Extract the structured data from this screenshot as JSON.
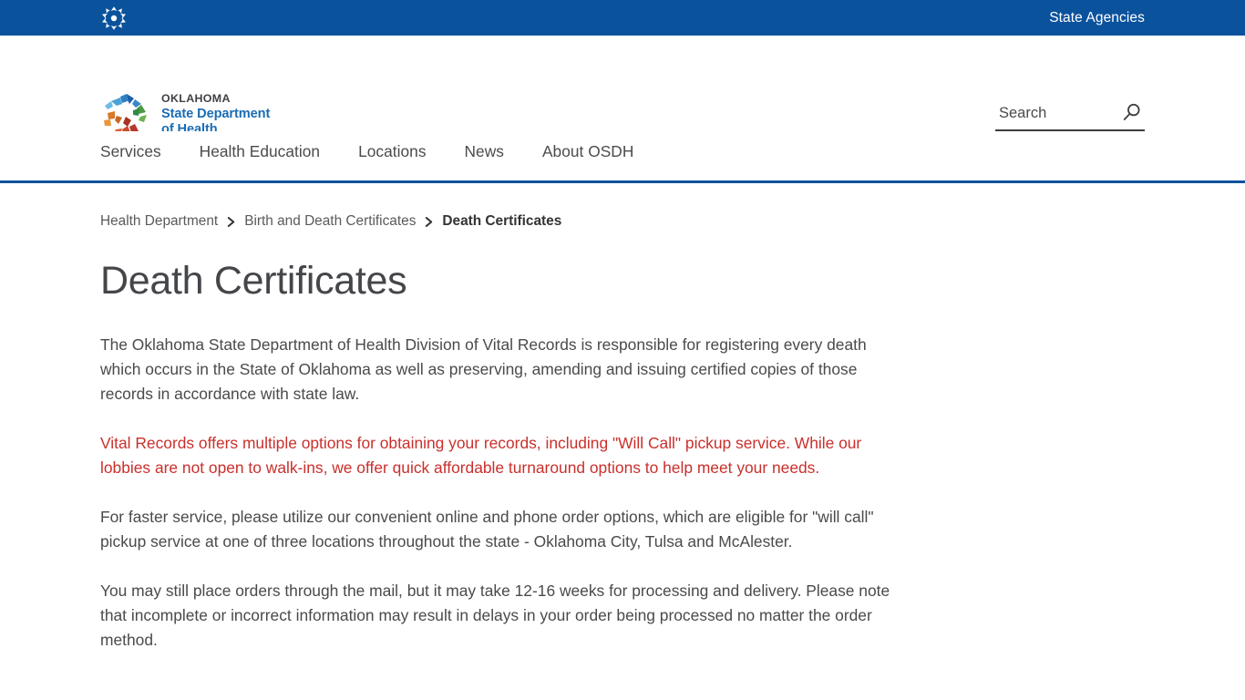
{
  "colors": {
    "brand_blue": "#0b529d",
    "alert_red": "#c9302c",
    "body_text": "#4a4a4a",
    "title_gray": "#44464a"
  },
  "topbar": {
    "seal_icon": "oklahoma-state-seal-icon",
    "links": [
      {
        "label": "State Agencies"
      }
    ]
  },
  "header": {
    "logo": {
      "mark_icon": "osdh-pinwheel-logo-icon",
      "line1": "OKLAHOMA",
      "line2": "State Department",
      "line3": "of Health"
    },
    "search": {
      "placeholder": "Search",
      "value": "",
      "icon": "search-icon"
    }
  },
  "nav": {
    "items": [
      {
        "label": "Services"
      },
      {
        "label": "Health Education"
      },
      {
        "label": "Locations"
      },
      {
        "label": "News"
      },
      {
        "label": "About OSDH"
      }
    ]
  },
  "breadcrumb": {
    "separator_icon": "chevron-right-icon",
    "items": [
      {
        "label": "Health Department",
        "current": false
      },
      {
        "label": "Birth and Death Certificates",
        "current": false
      },
      {
        "label": "Death Certificates",
        "current": true
      }
    ]
  },
  "main": {
    "title": "Death Certificates",
    "paragraphs": [
      {
        "style": "normal",
        "text": "The Oklahoma State Department of Health Division of Vital Records is responsible for registering every death which occurs in the State of Oklahoma as well as preserving, amending and issuing certified copies of those records in accordance with state law."
      },
      {
        "style": "alert",
        "text": "Vital Records offers multiple options for obtaining your records, including \"Will Call\" pickup service. While our lobbies are not open to walk-ins, we offer quick affordable turnaround options to help meet your needs."
      },
      {
        "style": "normal",
        "text": "For faster service, please utilize our convenient online and phone order options, which are eligible for \"will call\" pickup service at one of three locations throughout the state - Oklahoma City, Tulsa and McAlester."
      },
      {
        "style": "normal",
        "text": "You may still place orders through the mail, but it may take 12-16 weeks for processing and delivery. Please note that incomplete or incorrect information may result in delays in your order being processed no matter the order method."
      }
    ]
  }
}
